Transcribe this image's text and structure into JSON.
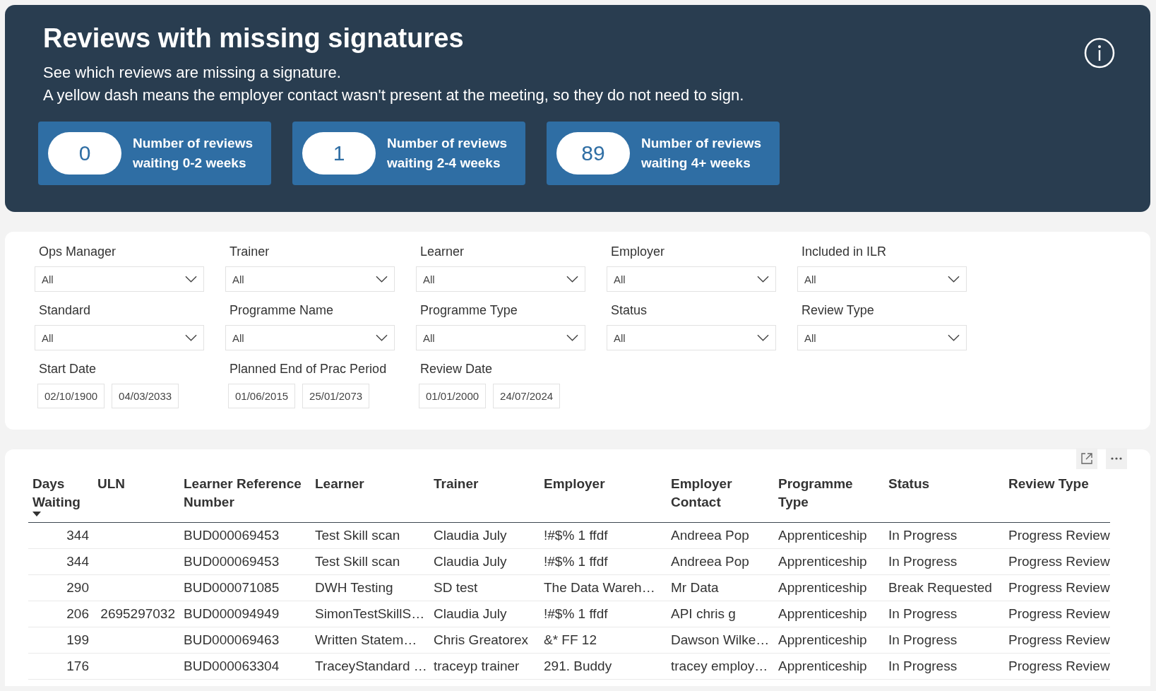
{
  "header": {
    "title": "Reviews with missing signatures",
    "description": [
      "See which reviews are missing a signature.",
      "A yellow dash means the employer contact wasn't present at the meeting, so they do not need to sign."
    ],
    "kpis": [
      {
        "count": "0",
        "caption": "Number of reviews waiting 0-2 weeks"
      },
      {
        "count": "1",
        "caption": "Number of reviews waiting 2-4 weeks"
      },
      {
        "count": "89",
        "caption": "Number of reviews waiting 4+ weeks"
      }
    ]
  },
  "filters": [
    {
      "kind": "dropdown",
      "label": "Ops Manager",
      "value": "All"
    },
    {
      "kind": "dropdown",
      "label": "Trainer",
      "value": "All"
    },
    {
      "kind": "dropdown",
      "label": "Learner",
      "value": "All"
    },
    {
      "kind": "dropdown",
      "label": "Employer",
      "value": "All"
    },
    {
      "kind": "dropdown",
      "label": "Included in ILR",
      "value": "All"
    },
    {
      "kind": "dropdown",
      "label": "Standard",
      "value": "All"
    },
    {
      "kind": "dropdown",
      "label": "Programme Name",
      "value": "All"
    },
    {
      "kind": "dropdown",
      "label": "Programme Type",
      "value": "All"
    },
    {
      "kind": "dropdown",
      "label": "Status",
      "value": "All"
    },
    {
      "kind": "dropdown",
      "label": "Review Type",
      "value": "All"
    },
    {
      "kind": "daterange",
      "label": "Start Date",
      "from": "02/10/1900",
      "to": "04/03/2033"
    },
    {
      "kind": "daterange",
      "label": "Planned End of Prac Period",
      "from": "01/06/2015",
      "to": "25/01/2073"
    },
    {
      "kind": "daterange",
      "label": "Review Date",
      "from": "01/01/2000",
      "to": "24/07/2024"
    }
  ],
  "table": {
    "columns": [
      {
        "label": "Days Waiting",
        "sorted": true
      },
      {
        "label": "ULN",
        "sorted": false
      },
      {
        "label": "Learner Reference Number",
        "sorted": false
      },
      {
        "label": "Learner",
        "sorted": false
      },
      {
        "label": "Trainer",
        "sorted": false
      },
      {
        "label": "Employer",
        "sorted": false
      },
      {
        "label": "Employer Contact",
        "sorted": false
      },
      {
        "label": "Programme Type",
        "sorted": false
      },
      {
        "label": "Status",
        "sorted": false
      },
      {
        "label": "Review Type",
        "sorted": false
      }
    ],
    "rows": [
      [
        "344",
        "",
        "BUD000069453",
        "Test Skill scan",
        "Claudia July",
        "!#$% 1 ffdf",
        "Andreea Pop",
        "Apprenticeship",
        "In Progress",
        "Progress Review"
      ],
      [
        "344",
        "",
        "BUD000069453",
        "Test Skill scan",
        "Claudia July",
        "!#$% 1 ffdf",
        "Andreea Pop",
        "Apprenticeship",
        "In Progress",
        "Progress Review"
      ],
      [
        "290",
        "",
        "BUD000071085",
        "DWH Testing",
        "SD test",
        "The Data Wareh…",
        "Mr Data",
        "Apprenticeship",
        "Break Requested",
        "Progress Review"
      ],
      [
        "206",
        "2695297032",
        "BUD000094949",
        "SimonTestSkillS…",
        "Claudia July",
        "!#$% 1 ffdf",
        "API chris g",
        "Apprenticeship",
        "In Progress",
        "Progress Review"
      ],
      [
        "199",
        "",
        "BUD000069463",
        "Written Statem…",
        "Chris  Greatorex",
        "&* FF 12",
        "Dawson Wilke…",
        "Apprenticeship",
        "In Progress",
        "Progress Review"
      ],
      [
        "176",
        "",
        "BUD000063304",
        "TraceyStandard …",
        "traceyp trainer",
        "291. Buddy",
        "tracey employ…",
        "Apprenticeship",
        "In Progress",
        "Progress Review"
      ]
    ]
  }
}
